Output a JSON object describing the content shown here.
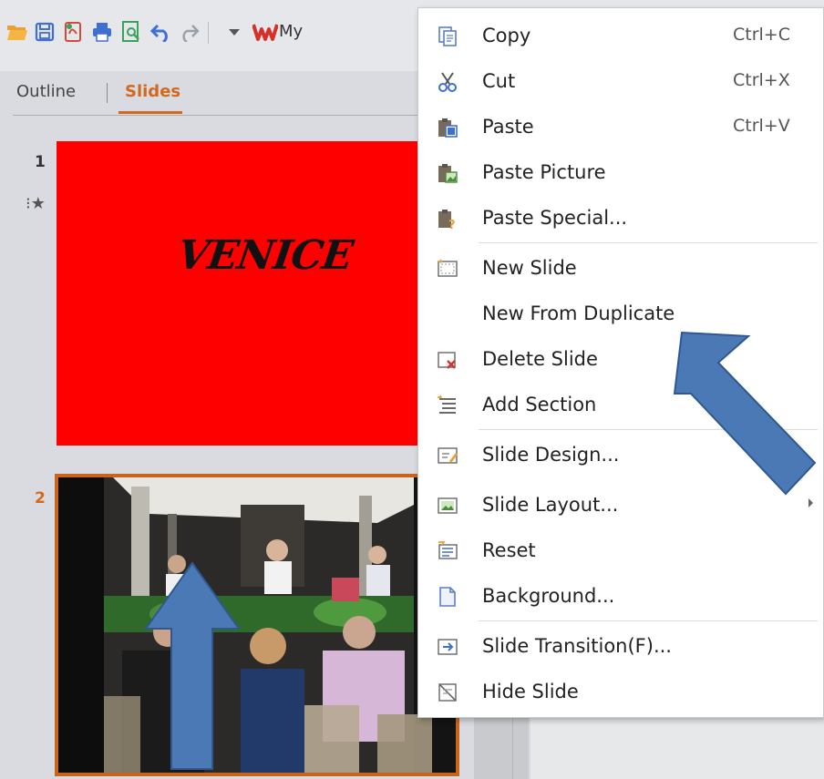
{
  "toolbar": {
    "icons": [
      "open-folder-icon",
      "save-icon",
      "export-pdf-icon",
      "print-icon",
      "print-preview-icon",
      "undo-icon",
      "redo-icon",
      "dropdown-arrow-icon",
      "wps-logo-icon"
    ],
    "account_label": "My"
  },
  "panel_tabs": {
    "outline": "Outline",
    "slides": "Slides",
    "active": "Slides"
  },
  "slides": [
    {
      "number": "1",
      "title": "VENICE",
      "background": "#ff0000",
      "has_animation": true
    },
    {
      "number": "2",
      "title": "",
      "description": "photo",
      "selected": true
    }
  ],
  "context_menu": {
    "items": [
      {
        "label": "Copy",
        "shortcut": "Ctrl+C",
        "icon": "copy-icon"
      },
      {
        "label": "Cut",
        "shortcut": "Ctrl+X",
        "icon": "scissors-icon"
      },
      {
        "label": "Paste",
        "shortcut": "Ctrl+V",
        "icon": "paste-icon"
      },
      {
        "label": "Paste Picture",
        "shortcut": "",
        "icon": "paste-picture-icon"
      },
      {
        "label": "Paste Special...",
        "shortcut": "",
        "icon": "paste-special-icon"
      },
      {
        "label": "New Slide",
        "shortcut": "",
        "icon": "new-slide-icon"
      },
      {
        "label": "New From Duplicate",
        "shortcut": "",
        "icon": ""
      },
      {
        "label": "Delete Slide",
        "shortcut": "",
        "icon": "delete-slide-icon"
      },
      {
        "label": "Add Section",
        "shortcut": "",
        "icon": "add-section-icon"
      },
      {
        "label": "Slide Design...",
        "shortcut": "",
        "icon": "slide-design-icon"
      },
      {
        "label": "Slide Layout...",
        "shortcut": "",
        "icon": "slide-layout-icon",
        "submenu": true
      },
      {
        "label": "Reset",
        "shortcut": "",
        "icon": "reset-icon"
      },
      {
        "label": "Background...",
        "shortcut": "",
        "icon": "background-icon"
      },
      {
        "label": "Slide Transition(F)...",
        "shortcut": "",
        "icon": "slide-transition-icon"
      },
      {
        "label": "Hide Slide",
        "shortcut": "",
        "icon": "hide-slide-icon"
      }
    ]
  },
  "colors": {
    "accent_orange": "#d2691e",
    "annotation_arrow": "#4a79b5",
    "slide1_background": "#ff0000"
  }
}
